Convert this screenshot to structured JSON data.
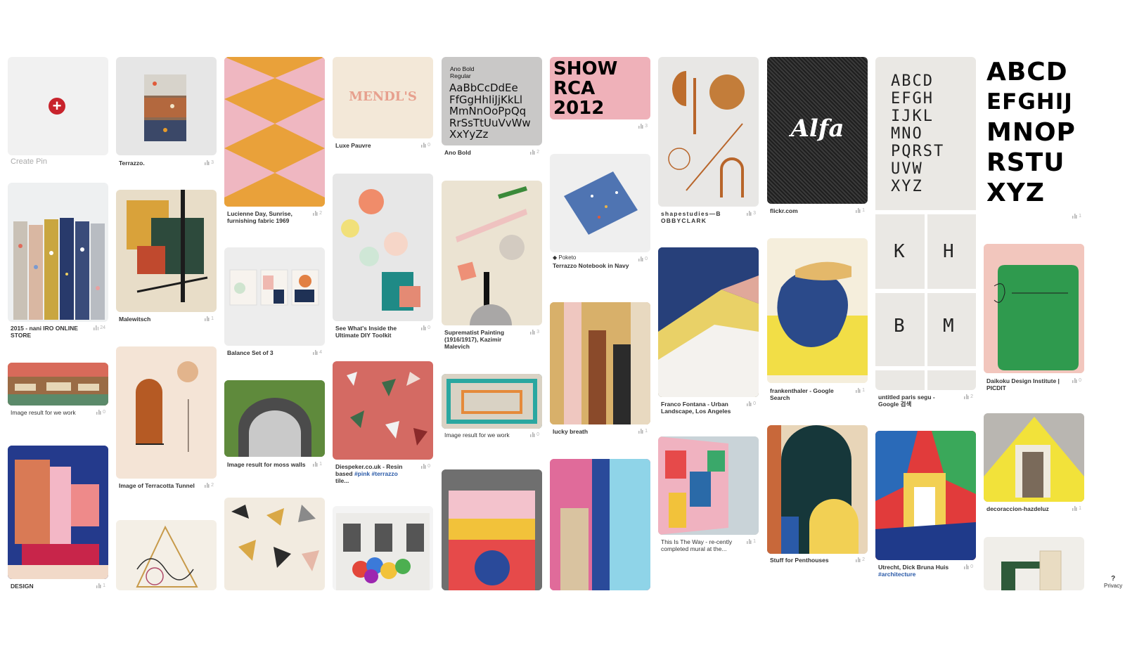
{
  "create_pin": {
    "label": "Create Pin"
  },
  "pins": [
    {
      "id": "terrazzo",
      "title": "Terrazzo.",
      "count": "3"
    },
    {
      "id": "nani-iro",
      "title": "2015 - nani IRO ONLINE STORE",
      "count": "24"
    },
    {
      "id": "image-we-work-1",
      "title": "Image result for we work",
      "count": "0"
    },
    {
      "id": "design",
      "title": "DESIGN",
      "count": "1"
    },
    {
      "id": "malewitsch",
      "title": "Malewitsch",
      "count": "1"
    },
    {
      "id": "terracotta",
      "title": "Image of Terracotta Tunnel",
      "count": "2"
    },
    {
      "id": "lucienne",
      "title": "Lucienne Day, Sunrise, furnishing fabric 1969",
      "count": "2"
    },
    {
      "id": "balance",
      "title": "Balance Set of 3",
      "count": "4"
    },
    {
      "id": "moss",
      "title": "Image result for moss walls",
      "count": "1"
    },
    {
      "id": "luxe",
      "title": "Luxe Pauvre",
      "count": "0",
      "image_text": "MENDL'S"
    },
    {
      "id": "diy",
      "title": "See What's Inside the Ultimate DIY Toolkit",
      "count": "0"
    },
    {
      "id": "diespeker",
      "title_pre": "Diespeker.co.uk - Resin based ",
      "tag1": "#pink",
      "tag2": "#terrazzo",
      "title_post": "tile...",
      "count": "0"
    },
    {
      "id": "ano",
      "title": "Ano Bold",
      "count": "2",
      "image_text": {
        "caption1": "Ano Bold",
        "caption2": "Regular",
        "lines": [
          "AaBbCcDdEe",
          "FfGgHhIiJjKkLl",
          "MmNnOoPpQq",
          "RrSsTtUuVvWw",
          "XxYyZz"
        ]
      }
    },
    {
      "id": "suprematist",
      "title": "Suprematist Painting (1916/1917), Kazimir Malevich",
      "count": "3"
    },
    {
      "id": "image-we-work-2",
      "title": "Image result for we work",
      "count": "0"
    },
    {
      "id": "show-rca",
      "count": "3",
      "image_text": [
        "SHOW",
        "RCA",
        "2012"
      ]
    },
    {
      "id": "notebook",
      "source": "Poketo",
      "title": "Terrazzo Notebook in Navy",
      "count": "0"
    },
    {
      "id": "lucky",
      "title": "lucky breath",
      "count": "1"
    },
    {
      "id": "shapestudies",
      "title": "shapestudies—B OBBYCLARK",
      "count": "3"
    },
    {
      "id": "fontana",
      "title": "Franco Fontana - Urban Landscape, Los Angeles",
      "count": "0"
    },
    {
      "id": "mural",
      "title": "This Is The Way - re-cently completed mural at the...",
      "count": "1"
    },
    {
      "id": "flickr",
      "title": "flickr.com",
      "count": "1",
      "image_text": "Alfa"
    },
    {
      "id": "frankenthaler",
      "title": "frankenthaler - Google Search",
      "count": "1"
    },
    {
      "id": "penthouses",
      "title": "Stuff for Penthouses",
      "count": "2"
    },
    {
      "id": "paris-segu",
      "title": "untitled paris segu - Google 검색",
      "count": "2"
    },
    {
      "id": "utrecht",
      "title_pre": "Utrecht, Dick Bruna Huis ",
      "tag1": "#architecture",
      "count": "0"
    },
    {
      "id": "abcd",
      "count": "1",
      "image_text": [
        "ABCD",
        "EFGHIJ",
        "MNOP",
        "RSTU",
        "XYZ"
      ]
    },
    {
      "id": "daikoku",
      "title": "Daikoku Design Institute | PICDIT",
      "count": "0"
    },
    {
      "id": "decoraccion",
      "title": "decoraccion-hazdeluz",
      "count": "1"
    }
  ],
  "privacy": {
    "icon": "?",
    "label": "Privacy"
  },
  "colors": {
    "create_plus": "#c8232c",
    "tag": "#2a5aa8",
    "count": "#b5b5b5"
  }
}
